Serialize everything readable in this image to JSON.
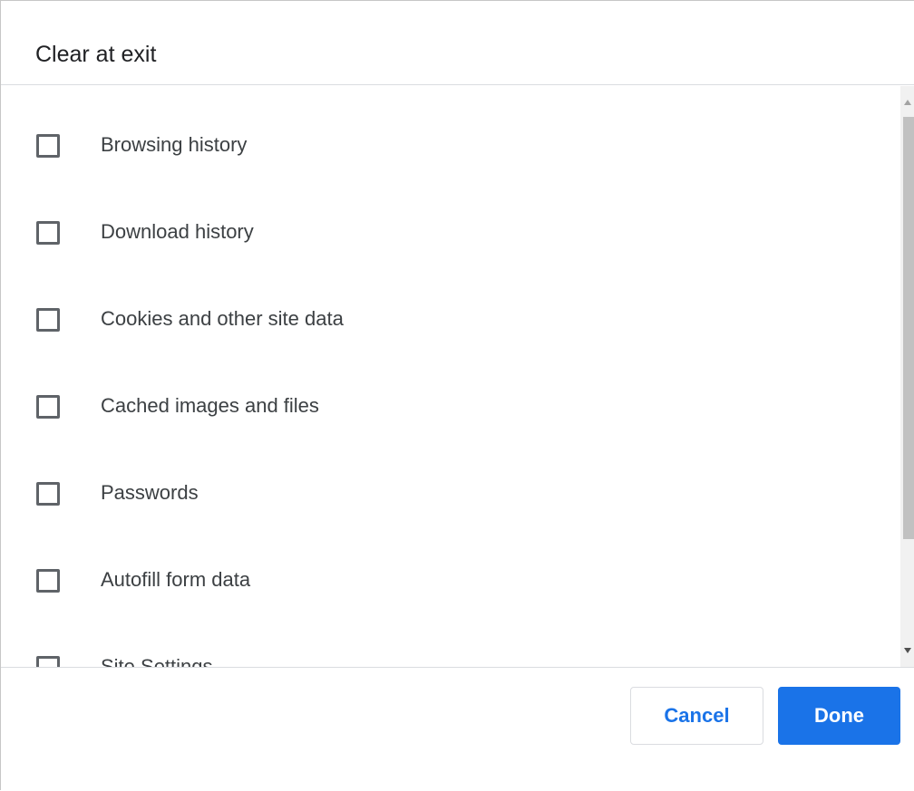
{
  "dialog": {
    "title": "Clear at exit"
  },
  "options": [
    {
      "label": "Browsing history",
      "checked": false
    },
    {
      "label": "Download history",
      "checked": false
    },
    {
      "label": "Cookies and other site data",
      "checked": false
    },
    {
      "label": "Cached images and files",
      "checked": false
    },
    {
      "label": "Passwords",
      "checked": false
    },
    {
      "label": "Autofill form data",
      "checked": false
    },
    {
      "label": "Site Settings",
      "checked": false
    }
  ],
  "footer": {
    "cancel_label": "Cancel",
    "done_label": "Done"
  },
  "colors": {
    "accent": "#1a73e8",
    "checkbox_border": "#5f6368",
    "text": "#3c4043",
    "divider": "#dadce0"
  }
}
